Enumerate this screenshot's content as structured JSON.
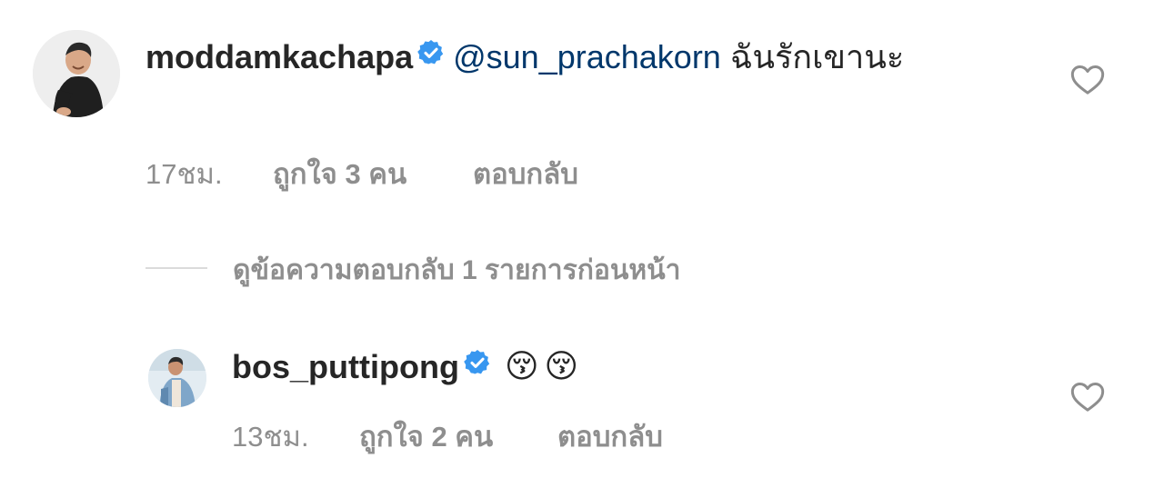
{
  "comments": [
    {
      "username": "moddamkachapa",
      "mention": "@sun_prachakorn",
      "text": "ฉันรักเขานะ",
      "time": "17ชม.",
      "likes": "ถูกใจ 3 คน",
      "reply": "ตอบกลับ",
      "avatar_icon": "profile-photo-man-black-shirt",
      "heart_icon": "heart-outline-icon",
      "verified_icon": "verified-badge-icon"
    },
    {
      "username": "bos_puttipong",
      "emojis": [
        "😚",
        "😚"
      ],
      "time": "13ชม.",
      "likes": "ถูกใจ 2 คน",
      "reply": "ตอบกลับ",
      "avatar_icon": "profile-photo-man-denim-jacket",
      "heart_icon": "heart-outline-icon",
      "verified_icon": "verified-badge-icon"
    }
  ],
  "view_replies": {
    "label": "ดูข้อความตอบกลับ 1 รายการก่อนหน้า"
  },
  "colors": {
    "text": "#262626",
    "secondary": "#8e8e8e",
    "mention": "#00376b",
    "verified": "#3897f0",
    "divider": "#dbdbdb",
    "background": "#ffffff"
  }
}
